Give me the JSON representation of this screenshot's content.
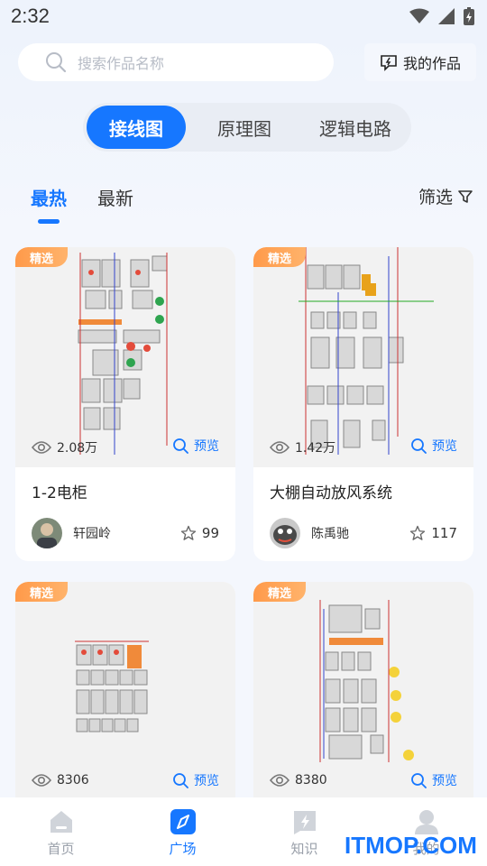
{
  "status": {
    "time": "2:32"
  },
  "search": {
    "placeholder": "搜索作品名称"
  },
  "header": {
    "my_works": "我的作品"
  },
  "segments": [
    "接线图",
    "原理图",
    "逻辑电路"
  ],
  "tabs": {
    "hot": "最热",
    "new": "最新",
    "filter": "筛选"
  },
  "cards": [
    {
      "badge": "精选",
      "views": "2.08万",
      "preview": "预览",
      "title": "1-2电柜",
      "author": "轩园岭",
      "likes": "99"
    },
    {
      "badge": "精选",
      "views": "1.42万",
      "preview": "预览",
      "title": "大棚自动放风系统",
      "author": "陈禹驰",
      "likes": "117"
    },
    {
      "badge": "精选",
      "views": "8306",
      "preview": "预览"
    },
    {
      "badge": "精选",
      "views": "8380",
      "preview": "预览"
    }
  ],
  "tabbar": [
    {
      "label": "首页",
      "icon": "home-icon"
    },
    {
      "label": "广场",
      "icon": "compass-icon"
    },
    {
      "label": "知识",
      "icon": "bolt-book-icon"
    },
    {
      "label": "我的",
      "icon": "user-icon"
    }
  ],
  "watermark": "ITMOP.COM",
  "colors": {
    "accent": "#1677ff",
    "badge": "#ff9a4a",
    "background": "#f4f7fd"
  }
}
